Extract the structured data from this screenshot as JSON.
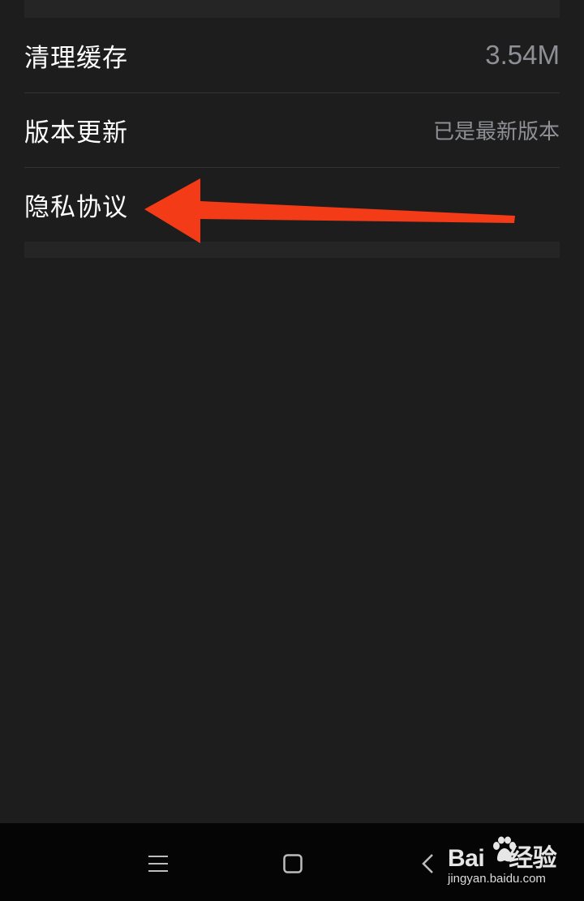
{
  "settings": {
    "items": [
      {
        "label": "清理缓存",
        "value": "3.54M"
      },
      {
        "label": "版本更新",
        "value": "已是最新版本"
      },
      {
        "label": "隐私协议",
        "value": ""
      }
    ]
  },
  "annotation": {
    "arrow_color": "#f43b17"
  },
  "navbar": {
    "buttons": [
      "menu-icon",
      "home-icon",
      "back-icon"
    ]
  },
  "watermark": {
    "brand_left": "Bai",
    "brand_right": "经验",
    "url": "jingyan.baidu.com"
  }
}
